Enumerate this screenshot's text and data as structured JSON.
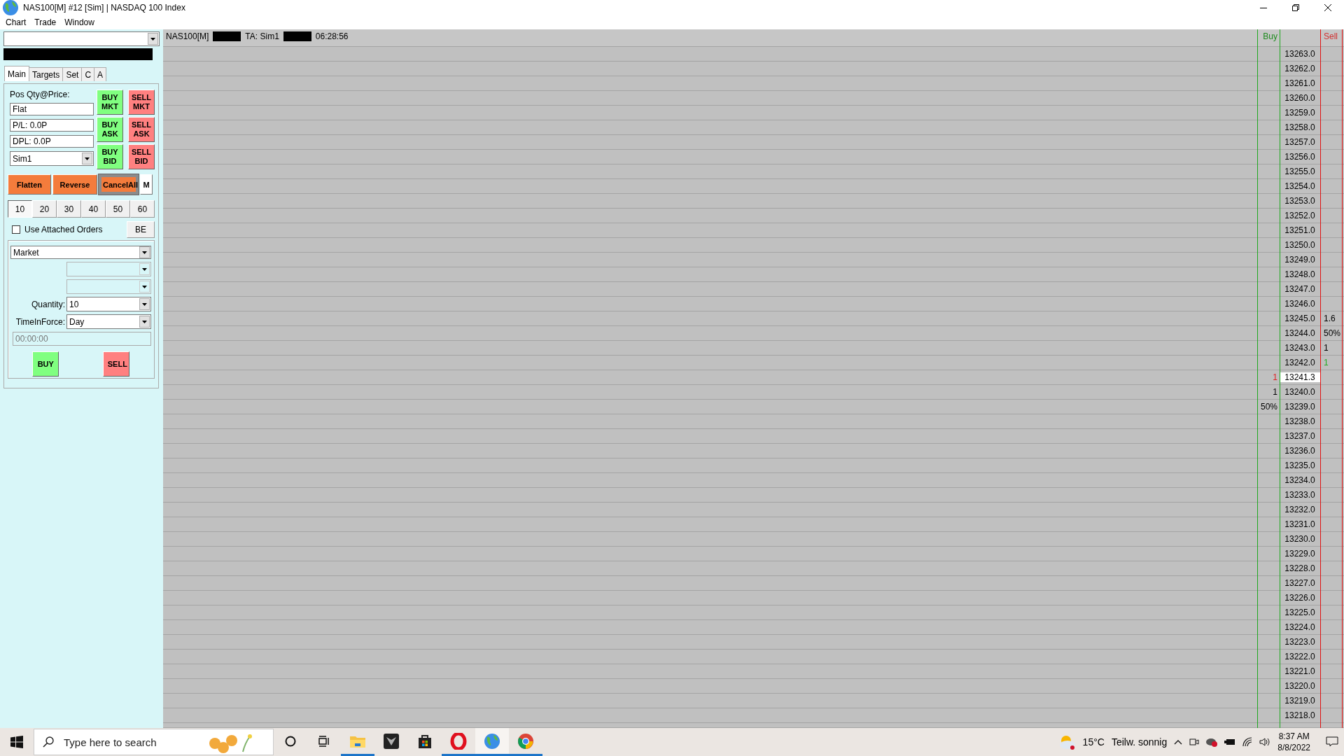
{
  "window": {
    "title": "NAS100[M]  #12 [Sim]  | NASDAQ 100 Index"
  },
  "menu": [
    "Chart",
    "Trade",
    "Window"
  ],
  "panel": {
    "tabs": [
      {
        "label": "Main",
        "selected": true
      },
      {
        "label": "Targets",
        "selected": false
      },
      {
        "label": "Set",
        "selected": false
      },
      {
        "label": "C",
        "selected": false
      },
      {
        "label": "A",
        "selected": false
      }
    ],
    "pos_label": "Pos Qty@Price:",
    "position": "Flat",
    "pl": "P/L: 0.0P",
    "dpl": "DPL: 0.0P",
    "account": "Sim1",
    "order_buttons": [
      {
        "label": "BUY MKT",
        "kind": "buy"
      },
      {
        "label": "SELL MKT",
        "kind": "sell"
      },
      {
        "label": "BUY ASK",
        "kind": "buy"
      },
      {
        "label": "SELL ASK",
        "kind": "sell"
      },
      {
        "label": "BUY BID",
        "kind": "buy"
      },
      {
        "label": "SELL BID",
        "kind": "sell"
      }
    ],
    "actions": [
      {
        "label": "Flatten",
        "kind": "orange",
        "focused": false
      },
      {
        "label": "Reverse",
        "kind": "orange",
        "focused": false
      },
      {
        "label": "CancelAll",
        "kind": "orange",
        "focused": true
      },
      {
        "label": "M",
        "kind": "plain",
        "focused": false
      }
    ],
    "quantities": [
      {
        "label": "10",
        "selected": true
      },
      {
        "label": "20",
        "selected": false
      },
      {
        "label": "30",
        "selected": false
      },
      {
        "label": "40",
        "selected": false
      },
      {
        "label": "50",
        "selected": false
      },
      {
        "label": "60",
        "selected": false
      }
    ],
    "attached_orders": {
      "label": "Use Attached Orders",
      "checked": false
    },
    "be_button": "BE",
    "order_type": "Market",
    "extra_fields": [
      {
        "disabled": true
      },
      {
        "disabled": true
      }
    ],
    "quantity": {
      "label": "Quantity:",
      "value": "10"
    },
    "tif": {
      "label": "TimeInForce:",
      "value": "Day"
    },
    "time": {
      "placeholder": "00:00:00",
      "disabled": true
    },
    "buy": "BUY",
    "sell": "SELL"
  },
  "chart": {
    "symbol": "NAS100[M]",
    "account": "TA: Sim1",
    "time": "06:28:56",
    "buy_label": "Buy",
    "sell_label": "Sell",
    "rows": [
      {
        "price": "13263.0",
        "last": false
      },
      {
        "price": "13262.0",
        "last": false
      },
      {
        "price": "13261.0",
        "last": false
      },
      {
        "price": "13260.0",
        "last": false
      },
      {
        "price": "13259.0",
        "last": false
      },
      {
        "price": "13258.0",
        "last": false
      },
      {
        "price": "13257.0",
        "last": false
      },
      {
        "price": "13256.0",
        "last": false
      },
      {
        "price": "13255.0",
        "last": false
      },
      {
        "price": "13254.0",
        "last": false
      },
      {
        "price": "13253.0",
        "last": false
      },
      {
        "price": "13252.0",
        "last": false
      },
      {
        "price": "13251.0",
        "last": false
      },
      {
        "price": "13250.0",
        "last": false
      },
      {
        "price": "13249.0",
        "last": false
      },
      {
        "price": "13248.0",
        "last": false
      },
      {
        "price": "13247.0",
        "last": false
      },
      {
        "price": "13246.0",
        "last": false
      },
      {
        "price": "13245.0",
        "last": false,
        "sell": {
          "text": "1.6",
          "color": "#000000"
        }
      },
      {
        "price": "13244.0",
        "last": false,
        "sell": {
          "text": "50%",
          "color": "#000000"
        }
      },
      {
        "price": "13243.0",
        "last": false,
        "sell": {
          "text": "1",
          "color": "#000000"
        }
      },
      {
        "price": "13242.0",
        "last": false,
        "sell": {
          "text": "1",
          "color": "#22aa22"
        }
      },
      {
        "price": "13241.3",
        "last": true,
        "buy": {
          "text": "1",
          "color": "#e02020"
        }
      },
      {
        "price": "13240.0",
        "last": false,
        "buy": {
          "text": "1",
          "color": "#000000"
        }
      },
      {
        "price": "13239.0",
        "last": false,
        "buy": {
          "text": "50%",
          "color": "#000000"
        }
      },
      {
        "price": "13238.0",
        "last": false
      },
      {
        "price": "13237.0",
        "last": false
      },
      {
        "price": "13236.0",
        "last": false
      },
      {
        "price": "13235.0",
        "last": false
      },
      {
        "price": "13234.0",
        "last": false
      },
      {
        "price": "13233.0",
        "last": false
      },
      {
        "price": "13232.0",
        "last": false
      },
      {
        "price": "13231.0",
        "last": false
      },
      {
        "price": "13230.0",
        "last": false
      },
      {
        "price": "13229.0",
        "last": false
      },
      {
        "price": "13228.0",
        "last": false
      },
      {
        "price": "13227.0",
        "last": false
      },
      {
        "price": "13226.0",
        "last": false
      },
      {
        "price": "13225.0",
        "last": false
      },
      {
        "price": "13224.0",
        "last": false
      },
      {
        "price": "13223.0",
        "last": false
      },
      {
        "price": "13222.0",
        "last": false
      },
      {
        "price": "13221.0",
        "last": false
      },
      {
        "price": "13220.0",
        "last": false
      },
      {
        "price": "13219.0",
        "last": false
      },
      {
        "price": "13218.0",
        "last": false
      }
    ]
  },
  "taskbar": {
    "search_placeholder": "Type here to search",
    "apps": [
      {
        "kind": "folder",
        "running": true,
        "selected": false
      },
      {
        "kind": "dark-app",
        "running": false,
        "selected": false
      },
      {
        "kind": "store",
        "running": false,
        "selected": false
      },
      {
        "kind": "opera",
        "running": true,
        "selected": false
      },
      {
        "kind": "globe",
        "running": true,
        "selected": true
      },
      {
        "kind": "chrome",
        "running": true,
        "selected": false
      }
    ],
    "temperature": "15°C",
    "weather": "Teilw. sonnig",
    "time": "8:37 AM",
    "date": "8/8/2022"
  }
}
